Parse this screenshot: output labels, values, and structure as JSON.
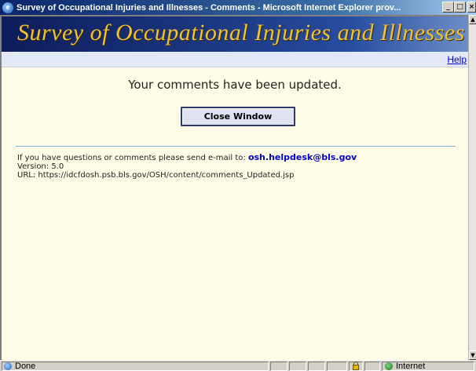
{
  "window": {
    "title": "Survey of Occupational Injuries and Illnesses - Comments - Microsoft Internet Explorer prov...",
    "minimize_glyph": "_",
    "maximize_glyph": "□",
    "close_glyph": "×"
  },
  "banner": {
    "title": "Survey of Occupational Injuries and Illnesses"
  },
  "nav": {
    "help_label": "Help"
  },
  "main": {
    "message": "Your comments have been updated.",
    "close_button_label": "Close Window"
  },
  "footer": {
    "contact_text": "If you have questions or comments please send e-mail to:",
    "email": "osh.helpdesk@bls.gov",
    "version": "Version: 5.0",
    "url": "URL: https://idcfdosh.psb.bls.gov/OSH/content/comments_Updated.jsp"
  },
  "statusbar": {
    "status_text": "Done",
    "zone_text": "Internet"
  },
  "colors": {
    "banner_text": "#f1c232",
    "banner_bg": "#1d3b86",
    "page_bg": "#fffde7",
    "link": "#0000cc"
  }
}
